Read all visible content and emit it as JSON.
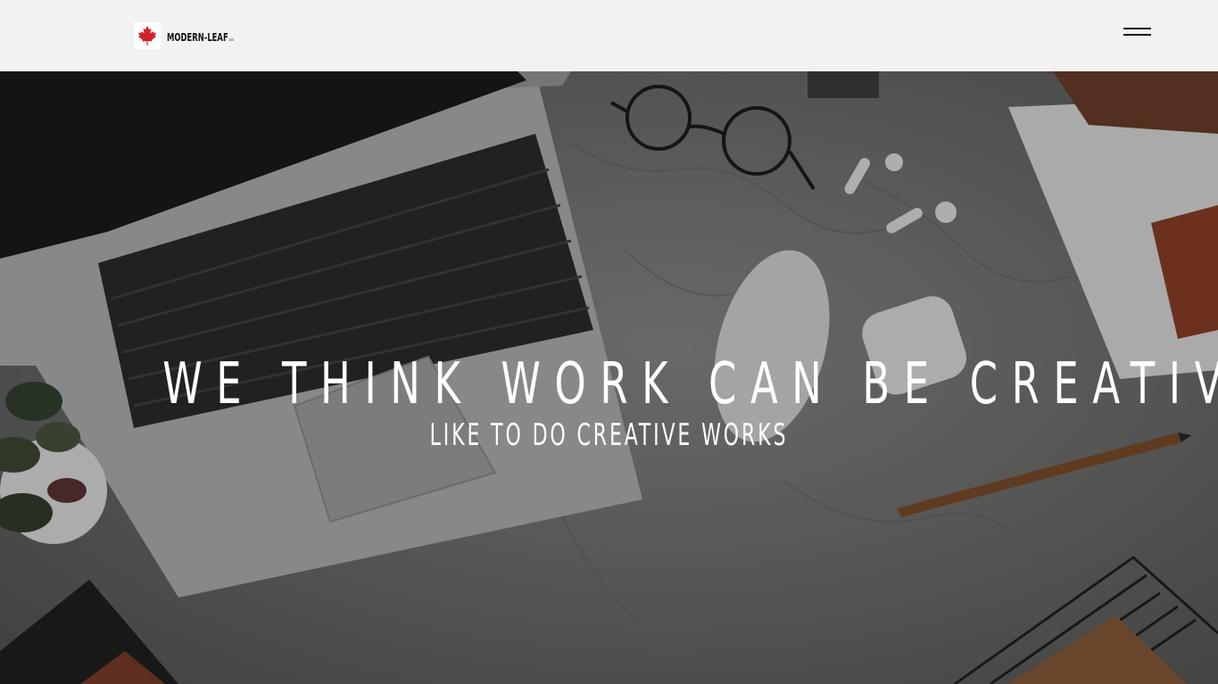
{
  "header": {
    "logo_text": "MODERN-LEAF",
    "logo_suffix": "sso",
    "logo_icon": "maple-leaf-icon",
    "menu_icon": "hamburger-menu-icon"
  },
  "hero": {
    "title": "WE THINK WORK CAN BE CREATIVE",
    "subtitle": "LIKE TO DO CREATIVE WORKS"
  },
  "colors": {
    "background": "#f2f2f2",
    "logo_leaf": "#d1232a",
    "text_dark": "#111111",
    "hero_text": "#ffffff"
  }
}
